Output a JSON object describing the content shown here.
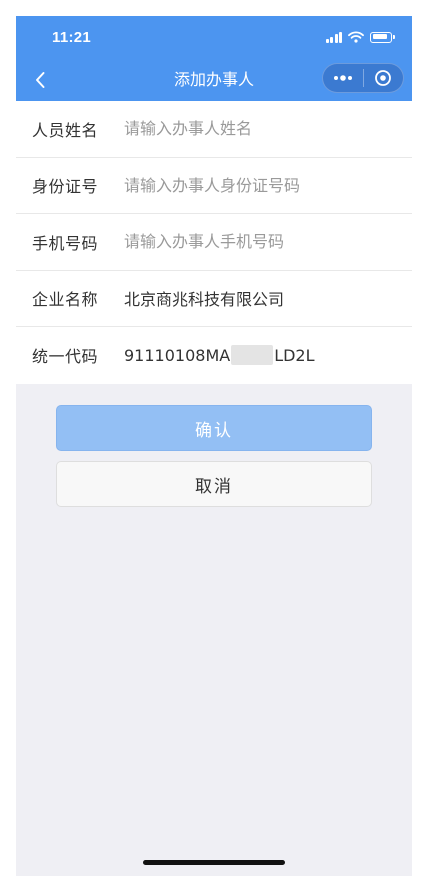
{
  "status_bar": {
    "time": "11:21"
  },
  "nav": {
    "title": "添加办事人",
    "accent_color": "#4c95f0"
  },
  "form": {
    "rows": [
      {
        "label": "人员姓名",
        "placeholder": "请输入办事人姓名"
      },
      {
        "label": "身份证号",
        "placeholder": "请输入办事人身份证号码"
      },
      {
        "label": "手机号码",
        "placeholder": "请输入办事人手机号码"
      },
      {
        "label": "企业名称",
        "value": "北京商兆科技有限公司"
      },
      {
        "label": "统一代码",
        "value_prefix": "91110108MA",
        "value_suffix": "LD2L"
      }
    ]
  },
  "buttons": {
    "confirm": "确认",
    "cancel": "取消"
  },
  "icons": {
    "back": "chevron-left-icon",
    "more": "more-dots-icon",
    "close": "target-close-icon",
    "signal": "signal-icon",
    "wifi": "wifi-icon",
    "battery": "battery-icon"
  }
}
